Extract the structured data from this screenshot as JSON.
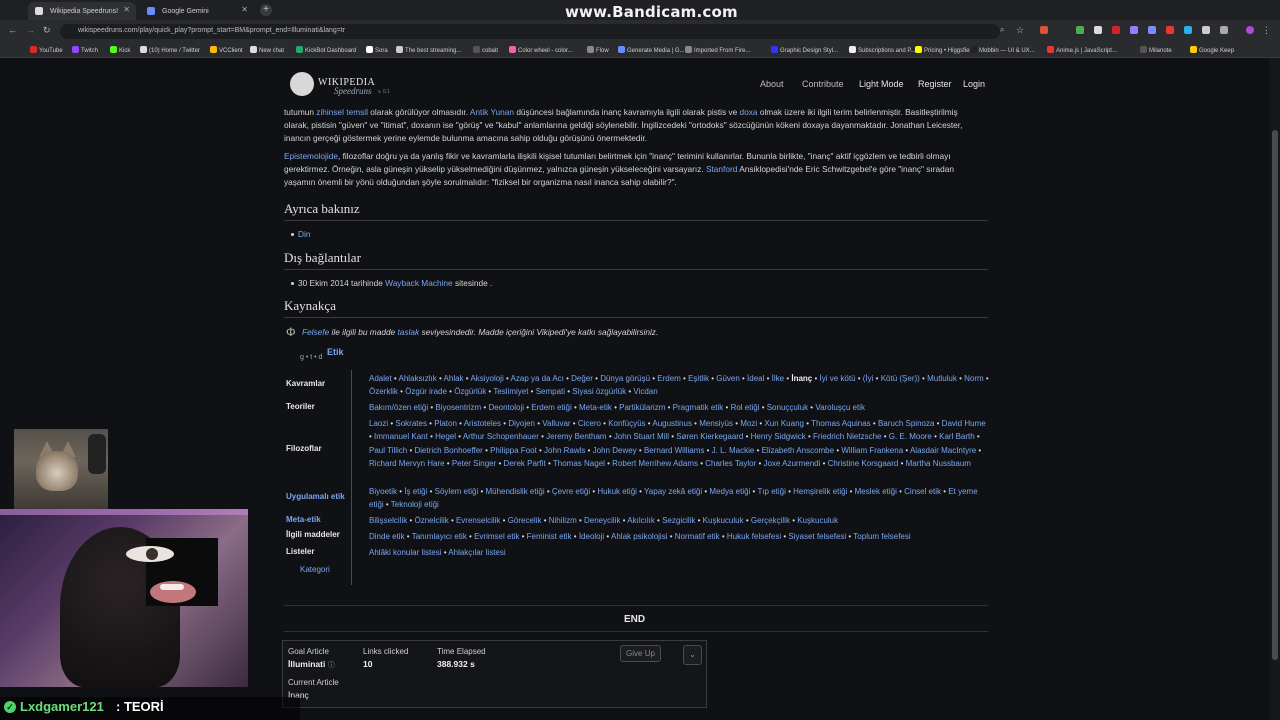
{
  "browser": {
    "tabs": [
      {
        "title": "Wikipedia Speedruns!",
        "active": true
      },
      {
        "title": "Google Gemini",
        "active": false
      }
    ],
    "new_tab_symbol": "+",
    "url": "wikispeedruns.com/play/quick_play?prompt_start=BM&prompt_end=Illuminati&lang=tr",
    "bookmarks": [
      "YouTube",
      "Twitch",
      "Kick",
      "(10) Home / Twitter",
      "VCClient",
      "New chat",
      "KickBot Dashboard",
      "Sora",
      "The best streaming...",
      "cobalt",
      "Color wheel - color...",
      "Flow",
      "Generate Media | G...",
      "Imported From Fire...",
      "Graphic Design Styl...",
      "Subscriptions and P...",
      "Pricing • Higgsfield",
      "Mobbin — UI & UX...",
      "Anime.js | JavaScript...",
      "Milanote",
      "Google Keep"
    ]
  },
  "watermark": "www.Bandicam.com",
  "site": {
    "logo_title": "WIKIPEDIA",
    "logo_subtitle": "Speedruns",
    "logo_version": "v. 0.1",
    "nav": [
      "About",
      "Contribute",
      "Light Mode",
      "Register",
      "Login"
    ]
  },
  "article": {
    "para1": [
      {
        "t": "tutumun "
      },
      {
        "t": "zihinsel temsil",
        "link": true
      },
      {
        "t": " olarak görülüyor olmasıdır. "
      },
      {
        "t": "Antik Yunan",
        "link": true
      },
      {
        "t": " düşüncesi bağlamında inanç kavramıyla ilgili olarak pistis ve "
      },
      {
        "t": "doxa",
        "link": true
      },
      {
        "t": " olmak üzere iki ilgili terim belirlenmiştir. Basitleştirilmiş olarak, pistisin \"güven\" ve \"itimat\", doxanın ise \"görüş\" ve \"kabul\" anlamlarına geldiği söylenebilir. İngilizcedeki \"ortodoks\" sözcüğünün kökeni doxaya dayanmaktadır. Jonathan Leicester, inancın gerçeği göstermek yerine eylemde bulunma amacına sahip olduğu görüşünü önermektedir."
      }
    ],
    "para2": [
      {
        "t": "Epistemolojide",
        "link": true
      },
      {
        "t": ", filozoflar doğru ya da yanlış fikir ve kavramlarla ilişkili kişisel tutumları belirtmek için \"inanç\" terimini kullanırlar. Bununla birlikte, \"inanç\" aktif içgözlem ve tedbirli olmayı gerektirmez. Örneğin, asla güneşin yükselip yükselmediğini düşünmez, yalnızca güneşin yükseleceğini varsayarız. "
      },
      {
        "t": "Stanford",
        "link": true
      },
      {
        "t": " Ansiklopedisi'nde Eric Schwitzgebel'e göre \"inanç\" sıradan yaşamın önemli bir yönü olduğundan şöyle sorulmalıdır: \"fiziksel bir organizma nasıl inanca sahip olabilir?\"."
      }
    ],
    "see_also_heading": "Ayrıca bakınız",
    "see_also_items": [
      "Din"
    ],
    "external_heading": "Dış bağlantılar",
    "external_prefix": "30 Ekim 2014 tarihinde ",
    "external_link": "Wayback Machine",
    "external_suffix": " sitesinde .",
    "refs_heading": "Kaynakça",
    "stub_icon": "Φ",
    "stub_link1": "Felsefe",
    "stub_text1": " ile ilgili bu madde ",
    "stub_link2": "taslak",
    "stub_text2": " seviyesindedir. Madde içeriğini Vikipedi'ye katkı sağlayabilirsiniz."
  },
  "navbox": {
    "vte": "g • t • d",
    "title": "Etik",
    "groups": [
      {
        "name": "Kavramlar",
        "items": [
          "Adalet",
          "Ahlaksızlık",
          "Ahlak",
          "Aksiyoloji",
          "Azap ya da Acı",
          "Değer",
          "Dünya görüşü",
          "Erdem",
          "Eşitlik",
          "Güven",
          "İdeal",
          "İlke",
          "İnanç",
          "İyi ve kötü",
          "(İyi",
          "Kötü (Şer))",
          "Mutluluk",
          "Norm",
          "Özerklik",
          "Özgür irade",
          "Özgürlük",
          "Teslimiyet",
          "Sempati",
          "Siyasi özgürlük",
          "Vicdan"
        ],
        "bold": "İnanç"
      },
      {
        "name": "Teoriler",
        "items": [
          "Bakım/özen etiği",
          "Biyosentrizm",
          "Deontoloji",
          "Erdem etiği",
          "Meta-etik",
          "Partikülarizm",
          "Pragmatik etik",
          "Rol etiği",
          "Sonuççuluk",
          "Varoluşçu etik"
        ]
      },
      {
        "name": "Filozoflar",
        "items": [
          "Laozi",
          "Sokrates",
          "Platon",
          "Aristoteles",
          "Diyojen",
          "Valluvar",
          "Cicero",
          "Konfüçyüs",
          "Augustinus",
          "Mensiyüs",
          "Mozi",
          "Xun Kuang",
          "Thomas Aquinas",
          "Baruch Spinoza",
          "David Hume",
          "Immanuel Kant",
          "Hegel",
          "Arthur Schopenhauer",
          "Jeremy Bentham",
          "John Stuart Mill",
          "Søren Kierkegaard",
          "Henry Sidgwick",
          "Friedrich Nietzsche",
          "G. E. Moore",
          "Karl Barth",
          "Paul Tillich",
          "Dietrich Bonhoeffer",
          "Philippa Foot",
          "John Rawls",
          "John Dewey",
          "Bernard Williams",
          "J. L. Mackie",
          "Elizabeth Anscombe",
          "William Frankena",
          "Alasdair MacIntyre",
          "Richard Mervyn Hare",
          "Peter Singer",
          "Derek Parfit",
          "Thomas Nagel",
          "Robert Merrihew Adams",
          "Charles Taylor",
          "Joxe Azurmendi",
          "Christine Korsgaard",
          "Martha Nussbaum"
        ]
      },
      {
        "name": "Uygulamalı etik",
        "items": [
          "Biyoetik",
          "İş etiği",
          "Söylem etiği",
          "Mühendislik etiği",
          "Çevre etiği",
          "Hukuk etiği",
          "Yapay zekâ etiği",
          "Medya etiği",
          "Tıp etiği",
          "Hemşirelik etiği",
          "Meslek etiği",
          "Cinsel etik",
          "Et yeme etiği",
          "Teknoloji etiği"
        ]
      },
      {
        "name": "Meta-etik",
        "items": [
          "Bilişselcilik",
          "Öznelcilik",
          "Evrenselcilik",
          "Görecelik",
          "Nihilizm",
          "Deneycilik",
          "Akılcılık",
          "Sezgicilik",
          "Kuşkuculuk",
          "Gerçekçilik",
          "Kuşkuculuk"
        ]
      },
      {
        "name": "İlgili maddeler",
        "items": [
          "Dinde etik",
          "Tanımlayıcı etik",
          "Evrimsel etik",
          "Feminist etik",
          "İdeoloji",
          "Ahlak psikolojisi",
          "Normatif etik",
          "Hukuk felsefesi",
          "Siyaset felsefesi",
          "Toplum felsefesi"
        ]
      },
      {
        "name": "Listeler",
        "items": [
          "Ahlâki konular listesi",
          "Ahlakçılar listesi"
        ]
      }
    ],
    "category_link": "Kategori"
  },
  "end_label": "END",
  "stats": {
    "goal_label": "Goal Article",
    "goal_value": "İlluminati",
    "links_label": "Links clicked",
    "links_value": "10",
    "time_label": "Time Elapsed",
    "time_value": "388.932 s",
    "current_label": "Current Article",
    "current_value": "İnanç",
    "give_up_label": "Give Up",
    "expand_symbol": "⌄",
    "info_symbol": "ⓘ"
  },
  "chat": {
    "user": "Lxdgamer121",
    "message": ": TEORİ",
    "check": "✓"
  },
  "colors": {
    "link": "#7aa7f0",
    "page_bg": "#101114",
    "chat_user": "#6fdc7b"
  }
}
